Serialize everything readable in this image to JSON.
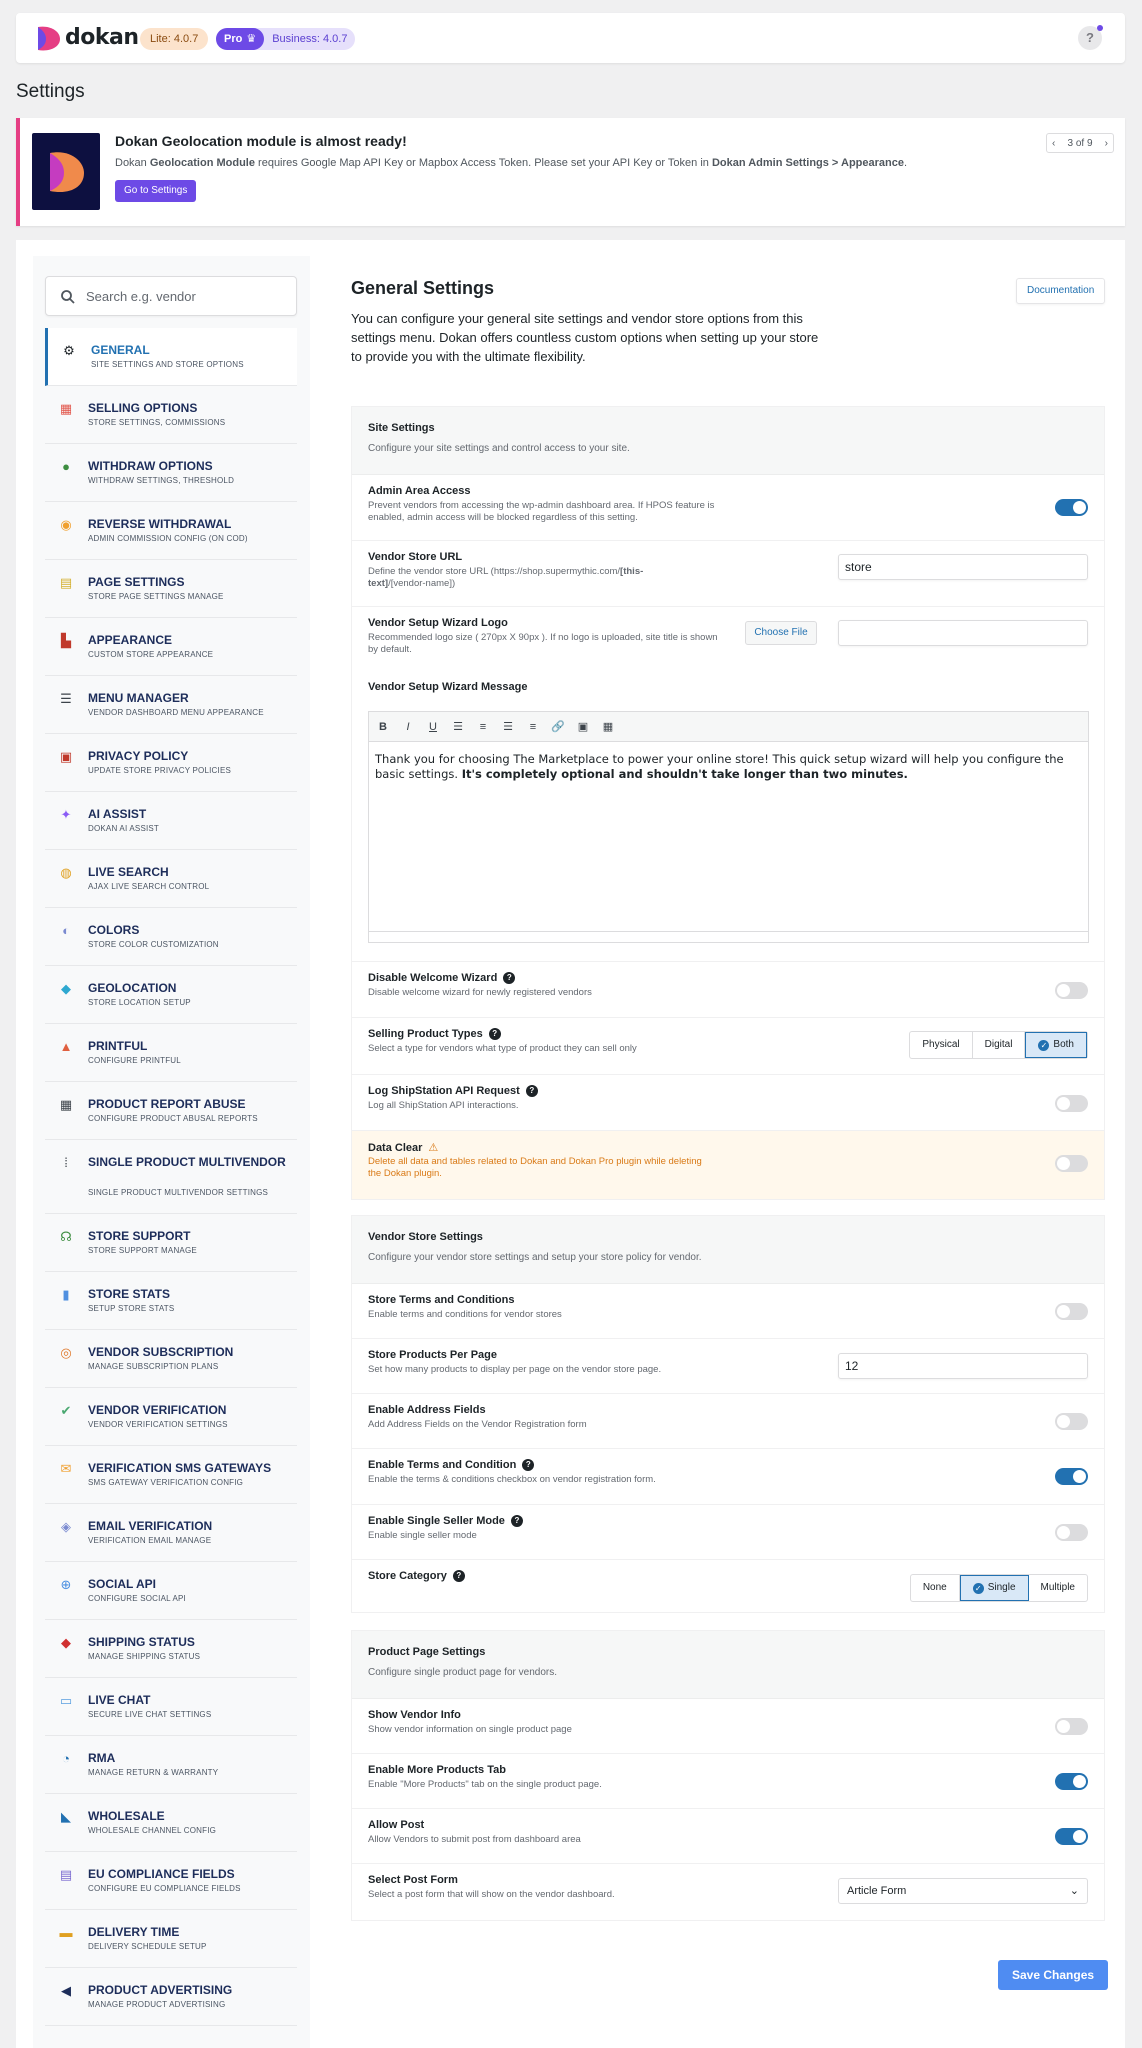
{
  "header": {
    "logo_text": "dokan",
    "lite_badge": "Lite: 4.0.7",
    "pro_label": "Pro",
    "business_badge": "Business: 4.0.7",
    "help_label": "?"
  },
  "page_title": "Settings",
  "notice": {
    "title": "Dokan Geolocation module is almost ready!",
    "text_before": "Dokan ",
    "text_bold1": "Geolocation Module",
    "text_mid": " requires Google Map API Key or Mapbox Access Token. Please set your API Key or Token in ",
    "text_bold2": "Dokan Admin Settings > Appearance",
    "text_end": ".",
    "button": "Go to Settings",
    "pager": "3 of 9"
  },
  "sidebar": {
    "search_placeholder": "Search e.g. vendor",
    "items": [
      {
        "title": "GENERAL",
        "sub": "SITE SETTINGS AND STORE OPTIONS",
        "icon": "gear-icon",
        "glyph": "⚙"
      },
      {
        "title": "SELLING OPTIONS",
        "sub": "STORE SETTINGS, COMMISSIONS",
        "icon": "store-icon",
        "glyph": "▦"
      },
      {
        "title": "WITHDRAW OPTIONS",
        "sub": "WITHDRAW SETTINGS, THRESHOLD",
        "icon": "money-icon",
        "glyph": "●"
      },
      {
        "title": "REVERSE WITHDRAWAL",
        "sub": "ADMIN COMMISSION CONFIG (ON COD)",
        "icon": "coin-icon",
        "glyph": "◉"
      },
      {
        "title": "PAGE SETTINGS",
        "sub": "STORE PAGE SETTINGS MANAGE",
        "icon": "page-icon",
        "glyph": "▤"
      },
      {
        "title": "APPEARANCE",
        "sub": "CUSTOM STORE APPEARANCE",
        "icon": "appearance-icon",
        "glyph": "▙"
      },
      {
        "title": "MENU MANAGER",
        "sub": "VENDOR DASHBOARD MENU APPEARANCE",
        "icon": "menu-icon",
        "glyph": "☰"
      },
      {
        "title": "PRIVACY POLICY",
        "sub": "UPDATE STORE PRIVACY POLICIES",
        "icon": "privacy-icon",
        "glyph": "▣"
      },
      {
        "title": "AI ASSIST",
        "sub": "DOKAN AI ASSIST",
        "icon": "sparkle-icon",
        "glyph": "✦"
      },
      {
        "title": "LIVE SEARCH",
        "sub": "AJAX LIVE SEARCH CONTROL",
        "icon": "live-search-icon",
        "glyph": "◍"
      },
      {
        "title": "COLORS",
        "sub": "STORE COLOR CUSTOMIZATION",
        "icon": "palette-icon",
        "glyph": "◐"
      },
      {
        "title": "GEOLOCATION",
        "sub": "STORE LOCATION SETUP",
        "icon": "location-icon",
        "glyph": "◆"
      },
      {
        "title": "PRINTFUL",
        "sub": "CONFIGURE PRINTFUL",
        "icon": "printful-icon",
        "glyph": "▲"
      },
      {
        "title": "PRODUCT REPORT ABUSE",
        "sub": "CONFIGURE PRODUCT ABUSAL REPORTS",
        "icon": "report-icon",
        "glyph": "▦"
      },
      {
        "title": "SINGLE PRODUCT MULTIVENDOR",
        "sub": "SINGLE PRODUCT MULTIVENDOR SETTINGS",
        "icon": "multivendor-icon",
        "glyph": "⁞",
        "tall": true
      },
      {
        "title": "STORE SUPPORT",
        "sub": "STORE SUPPORT MANAGE",
        "icon": "headset-icon",
        "glyph": "☊"
      },
      {
        "title": "STORE STATS",
        "sub": "SETUP STORE STATS",
        "icon": "stats-icon",
        "glyph": "▮"
      },
      {
        "title": "VENDOR SUBSCRIPTION",
        "sub": "MANAGE SUBSCRIPTION PLANS",
        "icon": "subscription-icon",
        "glyph": "◎"
      },
      {
        "title": "VENDOR VERIFICATION",
        "sub": "VENDOR VERIFICATION SETTINGS",
        "icon": "verification-icon",
        "glyph": "✔"
      },
      {
        "title": "VERIFICATION SMS GATEWAYS",
        "sub": "SMS GATEWAY VERIFICATION CONFIG",
        "icon": "sms-icon",
        "glyph": "✉"
      },
      {
        "title": "EMAIL VERIFICATION",
        "sub": "VERIFICATION EMAIL MANAGE",
        "icon": "shield-icon",
        "glyph": "◈"
      },
      {
        "title": "SOCIAL API",
        "sub": "CONFIGURE SOCIAL API",
        "icon": "social-icon",
        "glyph": "⊕"
      },
      {
        "title": "SHIPPING STATUS",
        "sub": "MANAGE SHIPPING STATUS",
        "icon": "shipping-icon",
        "glyph": "◆"
      },
      {
        "title": "LIVE CHAT",
        "sub": "SECURE LIVE CHAT SETTINGS",
        "icon": "chat-icon",
        "glyph": "▭"
      },
      {
        "title": "RMA",
        "sub": "MANAGE RETURN & WARRANTY",
        "icon": "rma-icon",
        "glyph": "◔"
      },
      {
        "title": "WHOLESALE",
        "sub": "WHOLESALE CHANNEL CONFIG",
        "icon": "wholesale-icon",
        "glyph": "◣"
      },
      {
        "title": "EU COMPLIANCE FIELDS",
        "sub": "CONFIGURE EU COMPLIANCE FIELDS",
        "icon": "eu-icon",
        "glyph": "▤"
      },
      {
        "title": "DELIVERY TIME",
        "sub": "DELIVERY SCHEDULE SETUP",
        "icon": "delivery-icon",
        "glyph": "▬"
      },
      {
        "title": "PRODUCT ADVERTISING",
        "sub": "MANAGE PRODUCT ADVERTISING",
        "icon": "megaphone-icon",
        "glyph": "◀"
      }
    ]
  },
  "content": {
    "title": "General Settings",
    "doc_button": "Documentation",
    "desc": "You can configure your general site settings and vendor store options from this settings menu. Dokan offers countless custom options when setting up your store to provide you with the ultimate flexibility.",
    "site": {
      "title": "Site Settings",
      "desc": "Configure your site settings and control access to your site.",
      "admin_title": "Admin Area Access",
      "admin_desc": "Prevent vendors from accessing the wp-admin dashboard area. If HPOS feature is enabled, admin access will be blocked regardless of this setting.",
      "store_url_title": "Vendor Store URL",
      "store_url_desc_a": "Define the vendor store URL (https://shop.supermythic.com/",
      "store_url_desc_b": "[this-text]",
      "store_url_desc_c": "/[vendor-name])",
      "store_url_value": "store",
      "logo_title": "Vendor Setup Wizard Logo",
      "logo_desc": "Recommended logo size ( 270px X 90px ). If no logo is uploaded, site title is shown by default.",
      "choose_file": "Choose File",
      "message_title": "Vendor Setup Wizard Message",
      "message_text": "Thank you for choosing The Marketplace to power your online store! This quick setup wizard will help you configure the basic settings. ",
      "message_bold": "It's completely optional and shouldn't take longer than two minutes.",
      "welcome_title": "Disable Welcome Wizard",
      "welcome_desc": "Disable welcome wizard for newly registered vendors",
      "product_types_title": "Selling Product Types",
      "product_types_desc": "Select a type for vendors what type of product they can sell only",
      "product_types_options": [
        "Physical",
        "Digital",
        "Both"
      ],
      "shipstation_title": "Log ShipStation API Request",
      "shipstation_desc": "Log all ShipStation API interactions.",
      "data_clear_title": "Data Clear",
      "data_clear_desc": "Delete all data and tables related to Dokan and Dokan Pro plugin while deleting the Dokan plugin."
    },
    "vendor": {
      "title": "Vendor Store Settings",
      "desc": "Configure your vendor store settings and setup your store policy for vendor.",
      "terms_title": "Store Terms and Conditions",
      "terms_desc": "Enable terms and conditions for vendor stores",
      "ppp_title": "Store Products Per Page",
      "ppp_desc": "Set how many products to display per page on the vendor store page.",
      "ppp_value": "12",
      "address_title": "Enable Address Fields",
      "address_desc": "Add Address Fields on the Vendor Registration form",
      "tc_title": "Enable Terms and Condition",
      "tc_desc": "Enable the terms & conditions checkbox on vendor registration form.",
      "single_seller_title": "Enable Single Seller Mode",
      "single_seller_desc": "Enable single seller mode",
      "category_title": "Store Category",
      "category_options": [
        "None",
        "Single",
        "Multiple"
      ]
    },
    "product": {
      "title": "Product Page Settings",
      "desc": "Configure single product page for vendors.",
      "vendor_info_title": "Show Vendor Info",
      "vendor_info_desc": "Show vendor information on single product page",
      "more_tab_title": "Enable More Products Tab",
      "more_tab_desc": "Enable \"More Products\" tab on the single product page.",
      "allow_post_title": "Allow Post",
      "allow_post_desc": "Allow Vendors to submit post from dashboard area",
      "post_form_title": "Select Post Form",
      "post_form_desc": "Select a post form that will show on the vendor dashboard.",
      "post_form_value": "Article Form"
    },
    "save_button": "Save Changes"
  },
  "colors": {
    "accent": "#2271b1",
    "brand": "#6d4ae6",
    "notice_border": "#e53e84",
    "warning": "#d97a17"
  }
}
